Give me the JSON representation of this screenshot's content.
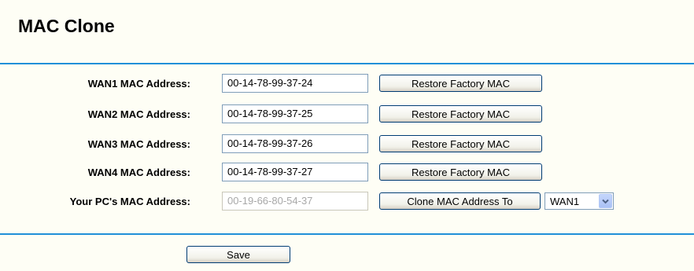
{
  "page": {
    "title": "MAC Clone"
  },
  "rows": [
    {
      "label": "WAN1 MAC Address:",
      "value": "00-14-78-99-37-24",
      "button": "Restore Factory MAC"
    },
    {
      "label": "WAN2 MAC Address:",
      "value": "00-14-78-99-37-25",
      "button": "Restore Factory MAC"
    },
    {
      "label": "WAN3 MAC Address:",
      "value": "00-14-78-99-37-26",
      "button": "Restore Factory MAC"
    },
    {
      "label": "WAN4 MAC Address:",
      "value": "00-14-78-99-37-27",
      "button": "Restore Factory MAC"
    }
  ],
  "pc": {
    "label": "Your PC's MAC Address:",
    "value": "00-19-66-80-54-37",
    "clone_button": "Clone MAC Address To",
    "wan_select": "WAN1"
  },
  "save_label": "Save",
  "colors": {
    "rule": "#2090d8",
    "background": "#fefef5"
  },
  "icons": {
    "select_arrow": "chevron-down-icon"
  }
}
